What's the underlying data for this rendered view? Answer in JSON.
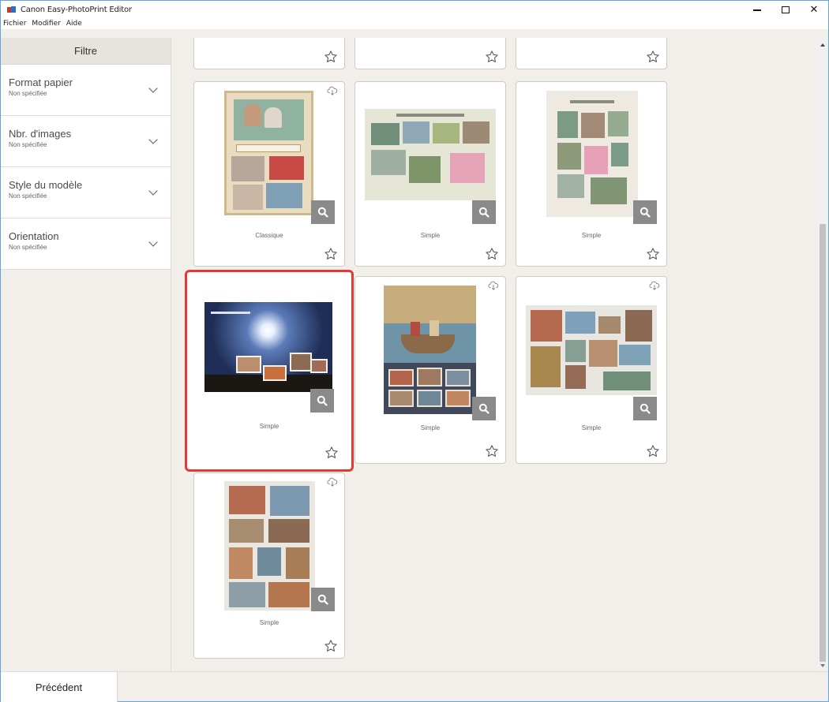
{
  "window": {
    "title": "Canon Easy-PhotoPrint Editor",
    "minimize_symbol": "−",
    "close_symbol": "✕"
  },
  "menu": [
    "Fichier",
    "Modifier",
    "Aide"
  ],
  "sidebar": {
    "header": "Filtre",
    "filters": [
      {
        "label": "Format papier",
        "value": "Non spécifiée"
      },
      {
        "label": "Nbr. d'images",
        "value": "Non spécifiée"
      },
      {
        "label": "Style du modèle",
        "value": "Non spécifiée"
      },
      {
        "label": "Orientation",
        "value": "Non spécifiée"
      }
    ]
  },
  "templates": [
    {
      "name": "",
      "cloud": false,
      "selected": false
    },
    {
      "name": "",
      "cloud": false,
      "selected": false
    },
    {
      "name": "",
      "cloud": false,
      "selected": false
    },
    {
      "name": "Classique",
      "cloud": true,
      "selected": false
    },
    {
      "name": "Simple",
      "cloud": false,
      "selected": false
    },
    {
      "name": "Simple",
      "cloud": false,
      "selected": false
    },
    {
      "name": "Simple",
      "cloud": false,
      "selected": true
    },
    {
      "name": "Simple",
      "cloud": true,
      "selected": false
    },
    {
      "name": "Simple",
      "cloud": true,
      "selected": false
    },
    {
      "name": "Simple",
      "cloud": true,
      "selected": false
    }
  ],
  "footer": {
    "previous_label": "Précédent"
  },
  "colors": {
    "selection": "#e53935",
    "zoom_button": "#8a8a8a"
  }
}
